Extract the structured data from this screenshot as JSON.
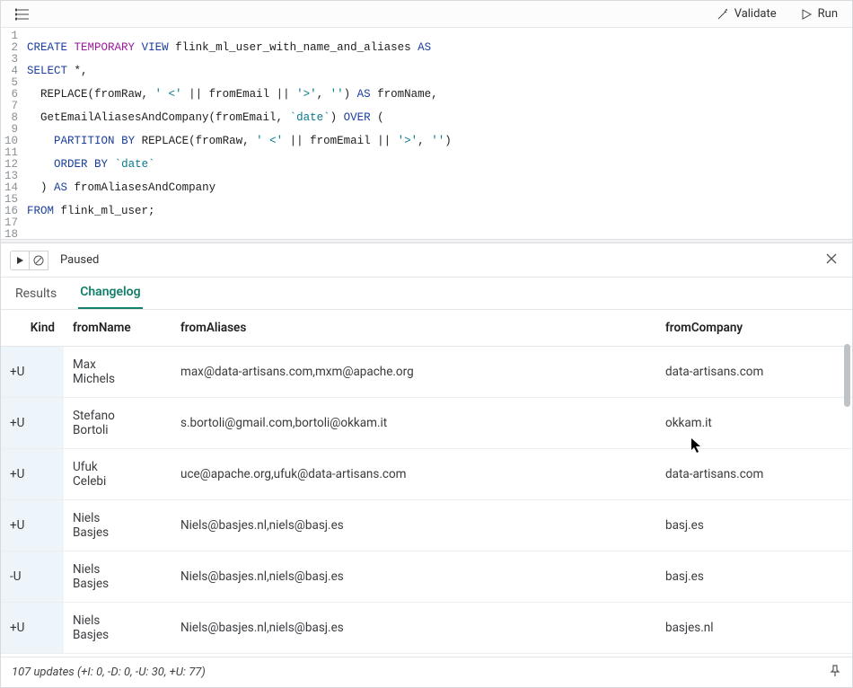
{
  "toolbar": {
    "validate_label": "Validate",
    "run_label": "Run"
  },
  "editor": {
    "lines": 18
  },
  "panel": {
    "status": "Paused",
    "tabs": {
      "results": "Results",
      "changelog": "Changelog"
    }
  },
  "table": {
    "headers": {
      "kind": "Kind",
      "fromName": "fromName",
      "fromAliases": "fromAliases",
      "fromCompany": "fromCompany"
    },
    "rows": [
      {
        "kind": "+U",
        "name1": "Max",
        "name2": "Michels",
        "aliases": "max@data-artisans.com,mxm@apache.org",
        "company": "data-artisans.com"
      },
      {
        "kind": "+U",
        "name1": "Stefano",
        "name2": "Bortoli",
        "aliases": "s.bortoli@gmail.com,bortoli@okkam.it",
        "company": "okkam.it"
      },
      {
        "kind": "+U",
        "name1": "Ufuk",
        "name2": "Celebi",
        "aliases": "uce@apache.org,ufuk@data-artisans.com",
        "company": "data-artisans.com"
      },
      {
        "kind": "+U",
        "name1": "Niels",
        "name2": "Basjes",
        "aliases": "Niels@basjes.nl,niels@basj.es",
        "company": "basj.es"
      },
      {
        "kind": "-U",
        "name1": "Niels",
        "name2": "Basjes",
        "aliases": "Niels@basjes.nl,niels@basj.es",
        "company": "basj.es"
      },
      {
        "kind": "+U",
        "name1": "Niels",
        "name2": "Basjes",
        "aliases": "Niels@basjes.nl,niels@basj.es",
        "company": "basjes.nl"
      }
    ]
  },
  "footer": {
    "summary": "107 updates (+I: 0, -D: 0, -U: 30, +U: 77)"
  }
}
